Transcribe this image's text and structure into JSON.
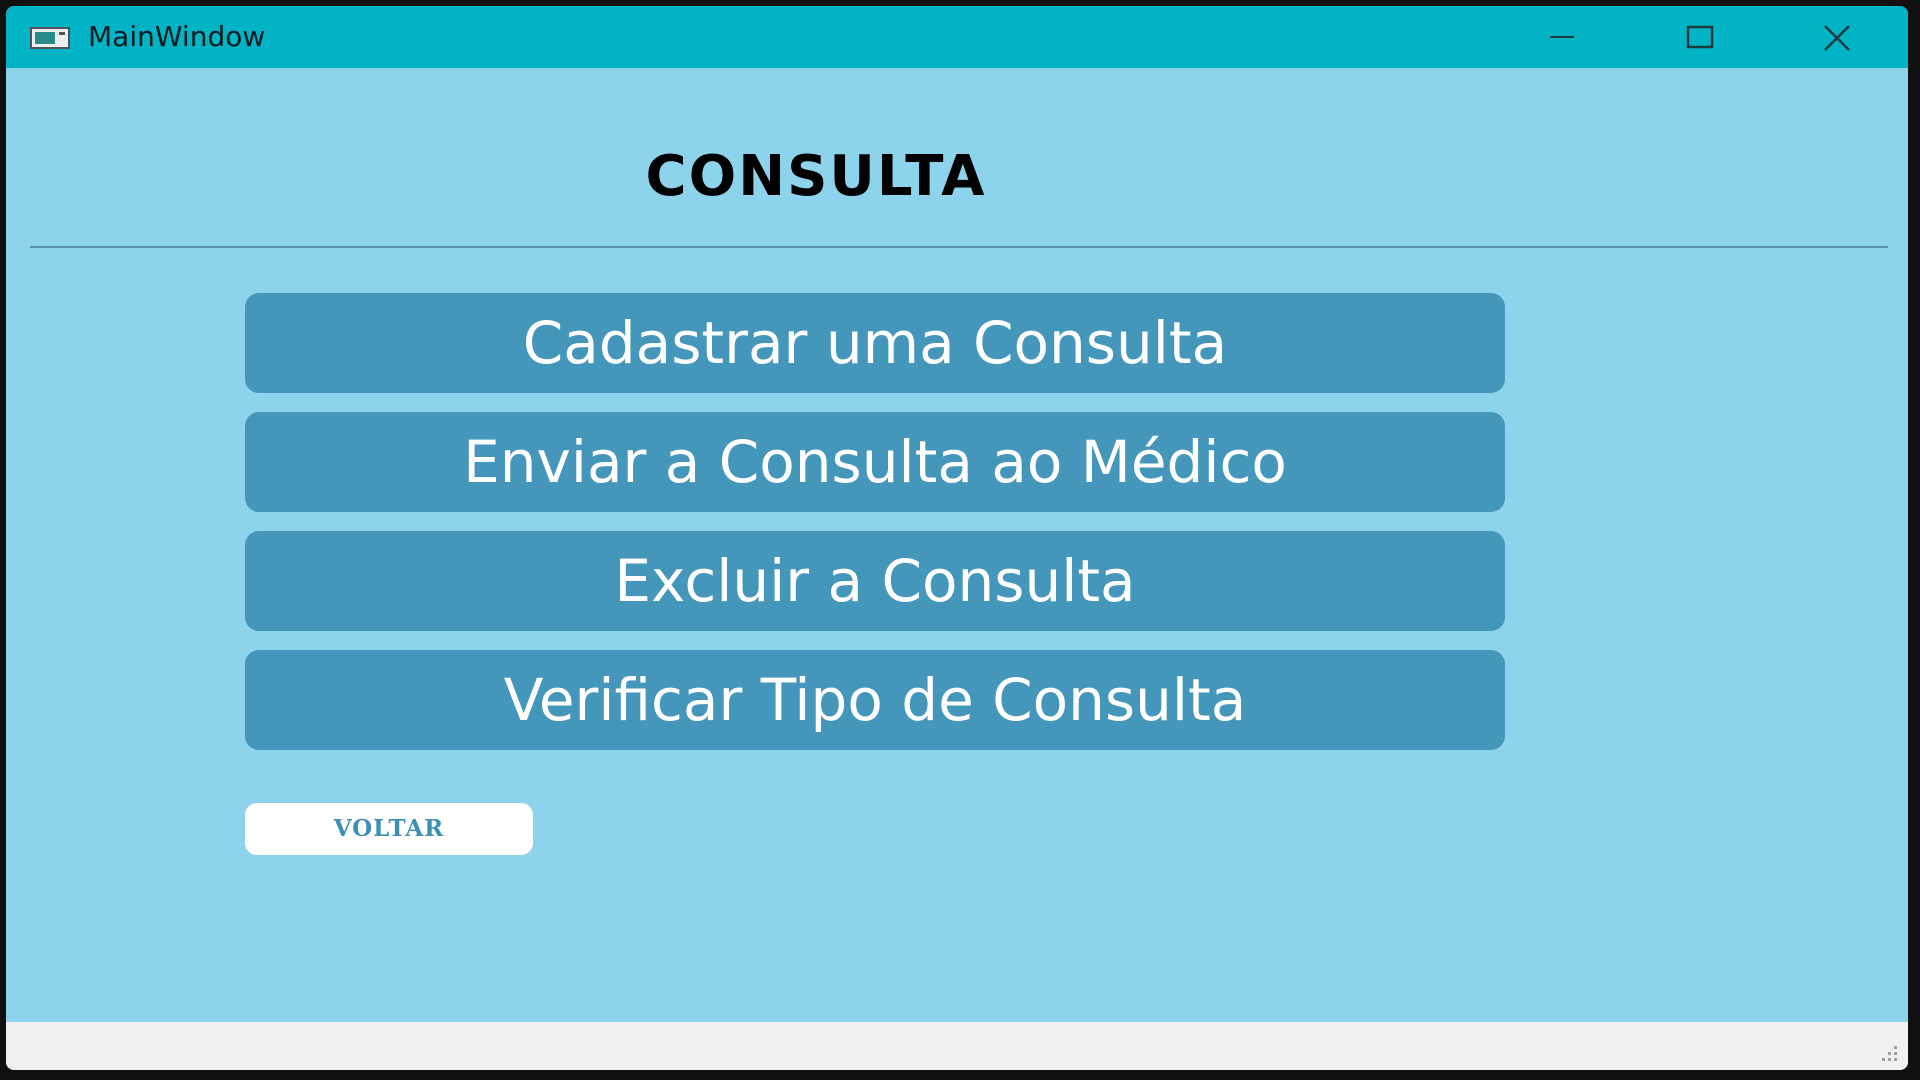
{
  "window": {
    "title": "MainWindow",
    "controls": [
      "minimize-icon",
      "maximize-icon",
      "close-icon"
    ]
  },
  "main": {
    "heading": "CONSULTA",
    "buttons": [
      {
        "label": "Cadastrar uma Consulta"
      },
      {
        "label": "Enviar a Consulta ao Médico"
      },
      {
        "label": "Excluir a Consulta"
      },
      {
        "label": "Verificar Tipo de Consulta"
      }
    ],
    "back_label": "VOLTAR"
  },
  "colors": {
    "titlebar": "#00b4c6",
    "background": "#8dd3ec",
    "button": "#4496bb",
    "back_text": "#3d8fb4",
    "statusbar": "#f0f0f0"
  }
}
